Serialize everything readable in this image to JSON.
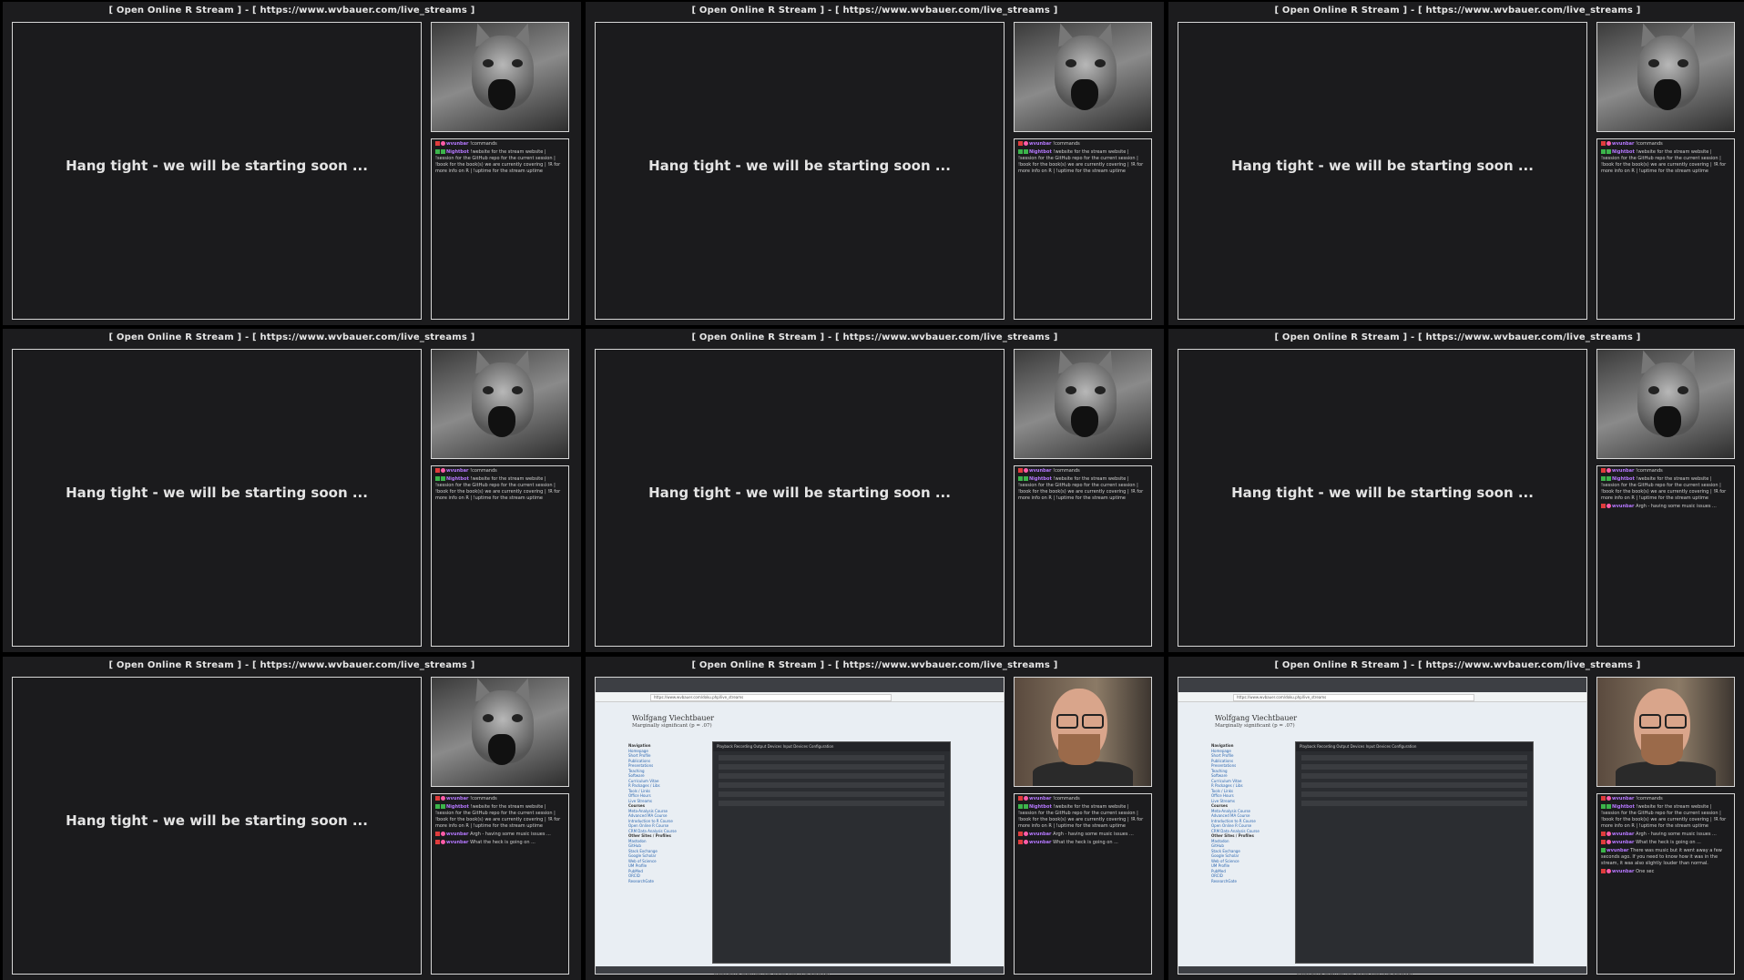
{
  "stream_title": "[ Open Online R Stream ] - [ https://www.wvbauer.com/live_streams ]",
  "standby_text": "Hang tight - we will be starting soon ...",
  "chat_users": {
    "commands_user": "wvunbar",
    "bot_user": "Nightbot",
    "viewer": "wvunbar"
  },
  "chat_messages": {
    "commands": "!commands",
    "bot": "!website for the stream website | !session for the GitHub repo for the current session | !book for the book(s) we are currently covering | !R for more info on R | !uptime for the stream uptime",
    "argh": "Argh - having some music issues ...",
    "heck": "What the heck is going on ...",
    "music": "There was music but it went away a few seconds ago. If you need to know how it was in the stream, it was also slightly louder than normal.",
    "onesec": "One sec"
  },
  "browser": {
    "url": "https://www.wvbauer.com/doku.php/live_streams",
    "name": "Wolfgang Viechtbauer",
    "subtitle": "Marginally significant (p = .07)",
    "nav": [
      "Navigation",
      "Homepage",
      "Short Profile",
      "Publications",
      "Presentations",
      "Teaching",
      "Software",
      "Curriculum Vitae",
      "R Packages / Libs",
      "Tools / Links",
      "Office Hours",
      "Live Streams",
      "Courses",
      "Meta-Analysis Course",
      "Advanced MA Course",
      "Introduction to R Course",
      "Open Online R Course",
      "CRM Data Analysis Course",
      "Other Sites / Profiles",
      "Mastodon",
      "GitHub",
      "Stack Exchange",
      "Google Scholar",
      "Web of Science",
      "UM Profile",
      "PubMed",
      "ORCID",
      "ResearchGate"
    ],
    "dialog_tabs": "Playback   Recording   Output Devices   Input Devices   Configuration",
    "note": "Note: The starting times are exact, but the ending times might fluctuate a bit. More details on the topic(s) to be covered in each stream will be added over time. Further dates to be announced."
  }
}
